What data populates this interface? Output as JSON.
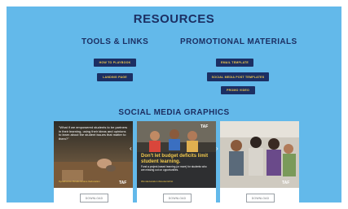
{
  "page": {
    "title": "RESOURCES"
  },
  "tools": {
    "heading": "TOOLS & LINKS",
    "buttons": [
      {
        "label": "HOW TO PLAYBOOK"
      },
      {
        "label": "LANDING PAGE"
      }
    ]
  },
  "promo": {
    "heading": "PROMOTIONAL MATERIALS",
    "buttons": [
      {
        "label": "EMAIL TEMPLATE"
      },
      {
        "label": "SOCIAL MEDIA POST TEMPLATES"
      },
      {
        "label": "PROMO VIDEO"
      }
    ]
  },
  "social": {
    "heading": "SOCIAL MEDIA GRAPHICS",
    "cards": [
      {
        "overlay": "\"What if we empowered students to be partners in their learning, using their ideas and opinions to learn about the student issues that matter to them?\"",
        "link": "#youthvoice #studentvoice #education",
        "logo": "TAF",
        "download": "DOWNLOAD"
      },
      {
        "logo": "TAF",
        "headline": "Don't let budget deficits limit student learning.",
        "sub": "Fund a project-based learning (or more) for students who are missing out on opportunities.",
        "link": "#fundeducation #studentsfirst",
        "download": "DOWNLOAD"
      },
      {
        "logo": "TAF",
        "download": "DOWNLOAD"
      }
    ]
  },
  "colors": {
    "background": "#63b9ea",
    "navy": "#1c2f63",
    "accent": "#f2c94c"
  }
}
